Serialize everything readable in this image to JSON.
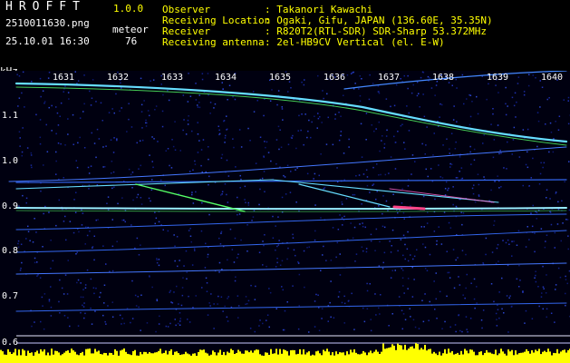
{
  "header": {
    "app_title": "HROFFT",
    "version": "1.0.0",
    "file_name": "2510011630.png",
    "datetime": "25.10.01 16:30",
    "stat_label": "meteor",
    "stat_value": "76"
  },
  "station": {
    "observer_label": "Observer",
    "observer_value": ": Takanori Kawachi",
    "location_label": "Receiving Location",
    "location_value": ": Ogaki, Gifu, JAPAN (136.60E, 35.35N)",
    "receiver_label": "Receiver",
    "receiver_value": ": R820T2(RTL-SDR) SDR-Sharp 53.372MHz",
    "antenna_label": "Receiving antenna",
    "antenna_value": ": 2el-HB9CV Vertical (el. E-W)"
  },
  "axes": {
    "freq_unit": "kHz",
    "y_ticks": [
      "1.1",
      "1.0",
      "0.9",
      "0.8",
      "0.7",
      "0.6"
    ],
    "x_ticks": [
      "1631",
      "1632",
      "1633",
      "1634",
      "1635",
      "1636",
      "1637",
      "1638",
      "1639",
      "1640"
    ]
  },
  "colors": {
    "background": "#000000",
    "label_yellow": "#ffff00",
    "noise_blue": "#1a2a9c",
    "trace_cyan": "#66ddff",
    "echo_green": "#55ff66",
    "level_yellow": "#ffff00"
  }
}
